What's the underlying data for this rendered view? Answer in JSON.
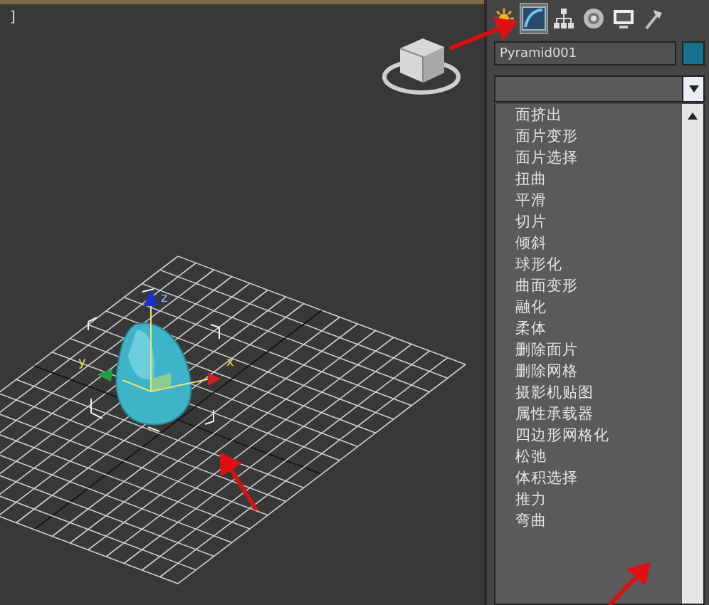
{
  "viewport": {
    "label": "]",
    "axis_labels": [
      "z",
      "y",
      "x"
    ]
  },
  "command_panel": {
    "tabs": [
      {
        "kind": "create",
        "selected": false
      },
      {
        "kind": "modify",
        "selected": true
      },
      {
        "kind": "hierarchy",
        "selected": false
      },
      {
        "kind": "motion",
        "selected": false
      },
      {
        "kind": "display",
        "selected": false
      },
      {
        "kind": "utilities",
        "selected": false
      }
    ],
    "object_name": "Pyramid001",
    "modifier_list": {
      "expanded": true,
      "items": [
        "面挤出",
        "面片变形",
        "面片选择",
        "扭曲",
        "平滑",
        "切片",
        "倾斜",
        "球形化",
        "曲面变形",
        "融化",
        "柔体",
        "删除面片",
        "删除网格",
        "摄影机贴图",
        "属性承载器",
        "四边形网格化",
        "松弛",
        "体积选择",
        "推力",
        "弯曲"
      ]
    }
  }
}
